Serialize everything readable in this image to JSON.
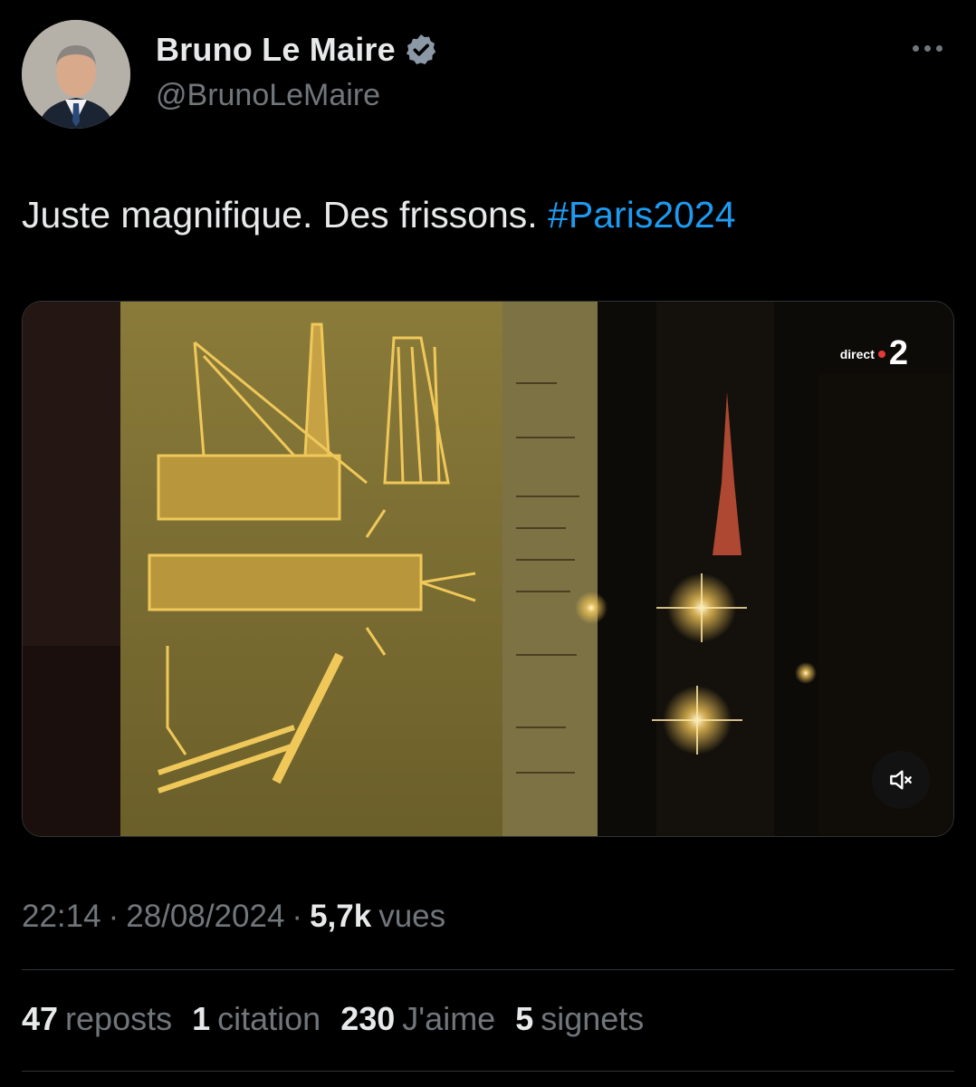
{
  "author": {
    "name": "Bruno Le Maire",
    "handle": "@BrunoLeMaire",
    "verified_color": "#8b98a5"
  },
  "tweet": {
    "text": "Juste magnifique. Des frissons.",
    "hashtag": "#Paris2024",
    "hashtag_color": "#1d9bf0"
  },
  "media": {
    "channel_label": "direct",
    "channel_number": "2",
    "mute_icon": "speaker-muted-icon"
  },
  "meta": {
    "time": "22:14",
    "date": "28/08/2024",
    "separator": "·",
    "views_count": "5,7k",
    "views_label": "vues"
  },
  "stats": [
    {
      "num": "47",
      "label": "reposts"
    },
    {
      "num": "1",
      "label": "citation"
    },
    {
      "num": "230",
      "label": "J'aime"
    },
    {
      "num": "5",
      "label": "signets"
    }
  ]
}
